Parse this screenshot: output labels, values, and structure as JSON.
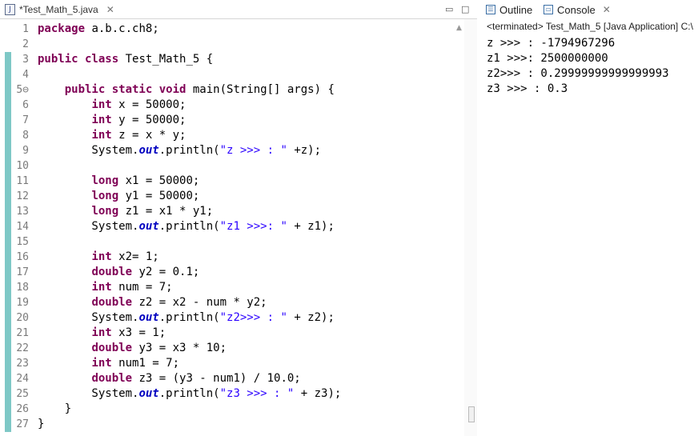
{
  "editor": {
    "tab_title": "*Test_Math_5.java",
    "tab_icon": "J",
    "close_glyph": "✕",
    "minimize_glyph": "▭",
    "maximize_glyph": "□"
  },
  "code_lines": [
    {
      "n": "1",
      "html": "<span class=\"kw\">package</span> a.b.c.ch8;"
    },
    {
      "n": "2",
      "html": ""
    },
    {
      "n": "3",
      "html": "<span class=\"kw\">public class</span> Test_Math_5 {"
    },
    {
      "n": "4",
      "html": ""
    },
    {
      "n": "5⊖",
      "html": "    <span class=\"kw\">public static void</span> main(String[] <span class=\"var\">args</span>) {"
    },
    {
      "n": "6",
      "html": "        <span class=\"kw\">int</span> x = 50000;"
    },
    {
      "n": "7",
      "html": "        <span class=\"kw\">int</span> y = 50000;"
    },
    {
      "n": "8",
      "html": "        <span class=\"kw\">int</span> z = x * y;"
    },
    {
      "n": "9",
      "html": "        System.<span class=\"fld\">out</span>.println(<span class=\"str\">\"z &gt;&gt;&gt; : \"</span> +z);"
    },
    {
      "n": "10",
      "html": ""
    },
    {
      "n": "11",
      "html": "        <span class=\"kw\">long</span> x1 = 50000;"
    },
    {
      "n": "12",
      "html": "        <span class=\"kw\">long</span> y1 = 50000;"
    },
    {
      "n": "13",
      "html": "        <span class=\"kw\">long</span> z1 = x1 * y1;"
    },
    {
      "n": "14",
      "html": "        System.<span class=\"fld\">out</span>.println(<span class=\"str\">\"z1 &gt;&gt;&gt;: \"</span> + z1);"
    },
    {
      "n": "15",
      "html": ""
    },
    {
      "n": "16",
      "html": "        <span class=\"kw\">int</span> x2= 1;"
    },
    {
      "n": "17",
      "html": "        <span class=\"kw\">double</span> y2 = 0.1;"
    },
    {
      "n": "18",
      "html": "        <span class=\"kw\">int</span> num = 7;"
    },
    {
      "n": "19",
      "html": "        <span class=\"kw\">double</span> z2 = x2 - num * y2;"
    },
    {
      "n": "20",
      "html": "        System.<span class=\"fld\">out</span>.println(<span class=\"str\">\"z2&gt;&gt;&gt; : \"</span> + z2);"
    },
    {
      "n": "21",
      "html": "        <span class=\"kw\">int</span> x3 = 1;"
    },
    {
      "n": "22",
      "html": "        <span class=\"kw\">double</span> y3 = x3 * 10;"
    },
    {
      "n": "23",
      "html": "        <span class=\"kw\">int</span> num1 = 7;"
    },
    {
      "n": "24",
      "html": "        <span class=\"kw\">double</span> z3 = (y3 - num1) / 10.0;"
    },
    {
      "n": "25",
      "html": "        System.<span class=\"fld\">out</span>.println(<span class=\"str\">\"z3 &gt;&gt;&gt; : \"</span> + z3);"
    },
    {
      "n": "26",
      "html": "    }"
    },
    {
      "n": "27",
      "html": "}"
    }
  ],
  "right_panel": {
    "outline_label": "Outline",
    "console_label": "Console",
    "close_glyph": "✕",
    "status": "<terminated> Test_Math_5 [Java Application] C:\\",
    "output": [
      "z >>> : -1794967296",
      "z1 >>>: 2500000000",
      "z2>>> : 0.29999999999999993",
      "z3 >>> : 0.3"
    ]
  }
}
